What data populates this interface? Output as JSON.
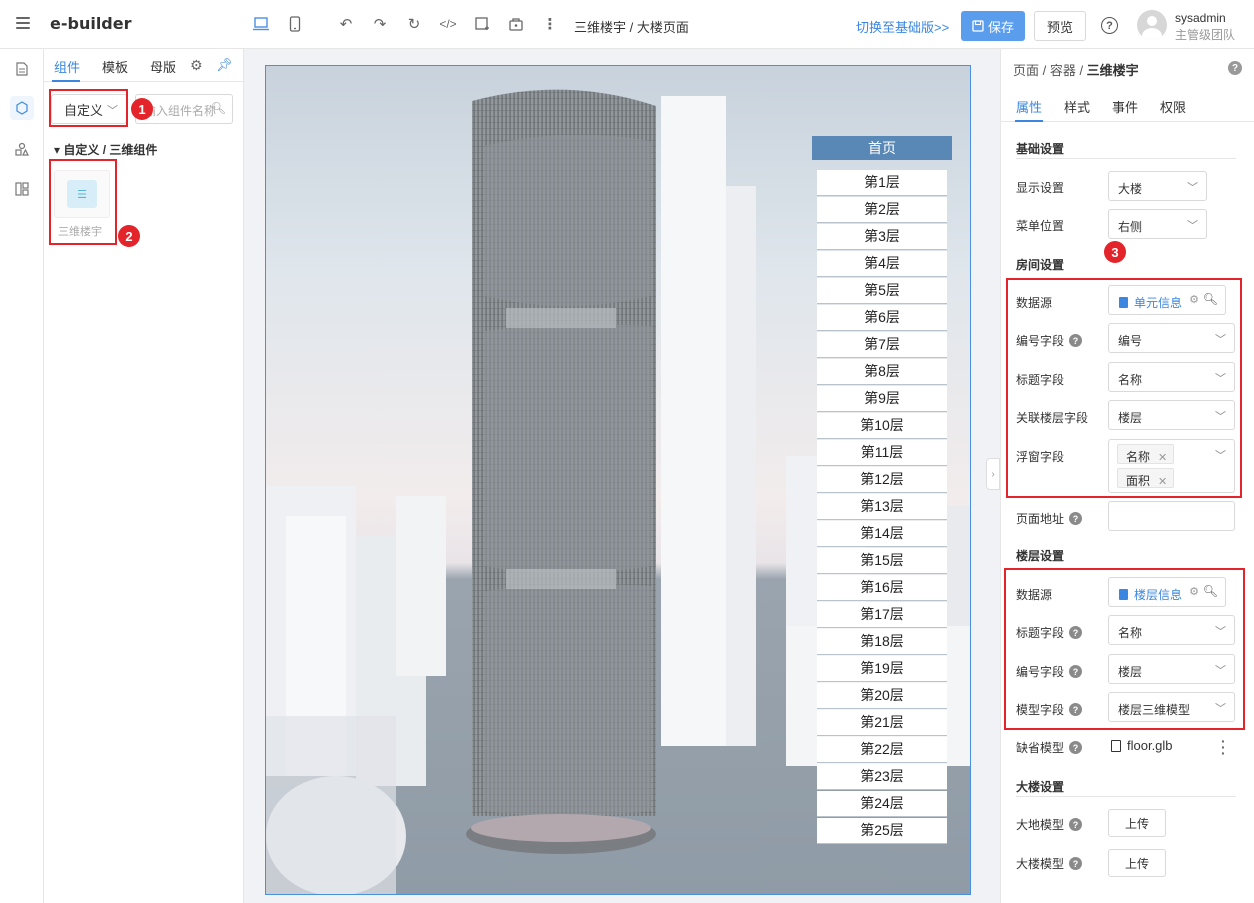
{
  "app": {
    "title": "e-builder"
  },
  "header": {
    "breadcrumb": "三维楼宇 / 大楼页面",
    "switch_label": "切换至基础版>>",
    "save_label": "保存",
    "preview_label": "预览",
    "help": "?",
    "user_name": "sysadmin",
    "user_team": "主管级团队"
  },
  "left_panel": {
    "tabs": [
      {
        "label": "组件"
      },
      {
        "label": "模板"
      },
      {
        "label": "母版"
      }
    ],
    "category_select": "自定义",
    "search_placeholder": "输入组件名称",
    "group_title": "自定义 / 三维组件",
    "component_label": "三维楼宇"
  },
  "annotations": {
    "one": "1",
    "two": "2",
    "three": "3"
  },
  "canvas": {
    "menu_head": "首页",
    "floors": [
      "第1层",
      "第2层",
      "第3层",
      "第4层",
      "第5层",
      "第6层",
      "第7层",
      "第8层",
      "第9层",
      "第10层",
      "第11层",
      "第12层",
      "第13层",
      "第14层",
      "第15层",
      "第16层",
      "第17层",
      "第18层",
      "第19层",
      "第20层",
      "第21层",
      "第22层",
      "第23层",
      "第24层",
      "第25层"
    ]
  },
  "props": {
    "breadcrumb_a": "页面 / 容器 / ",
    "breadcrumb_b": "三维楼宇",
    "tabs": [
      {
        "label": "属性"
      },
      {
        "label": "样式"
      },
      {
        "label": "事件"
      },
      {
        "label": "权限"
      }
    ],
    "basic": {
      "title": "基础设置",
      "display_label": "显示设置",
      "display_value": "大楼",
      "menu_pos_label": "菜单位置",
      "menu_pos_value": "右侧"
    },
    "room": {
      "title": "房间设置",
      "datasource_label": "数据源",
      "datasource_value": "单元信息",
      "code_label": "编号字段",
      "code_value": "编号",
      "title_label": "标题字段",
      "title_value": "名称",
      "floor_field_label": "关联楼层字段",
      "floor_field_value": "楼层",
      "float_label": "浮窗字段",
      "float_tags": [
        "名称",
        "面积"
      ],
      "page_url_label": "页面地址"
    },
    "floor": {
      "title": "楼层设置",
      "datasource_label": "数据源",
      "datasource_value": "楼层信息",
      "title_label": "标题字段",
      "title_value": "名称",
      "code_label": "编号字段",
      "code_value": "楼层",
      "model_label": "模型字段",
      "model_value": "楼层三维模型",
      "default_model_label": "缺省模型",
      "default_model_file": "floor.glb"
    },
    "building": {
      "title": "大楼设置",
      "ground_label": "大地模型",
      "building_label": "大楼模型",
      "upload": "上传"
    }
  }
}
